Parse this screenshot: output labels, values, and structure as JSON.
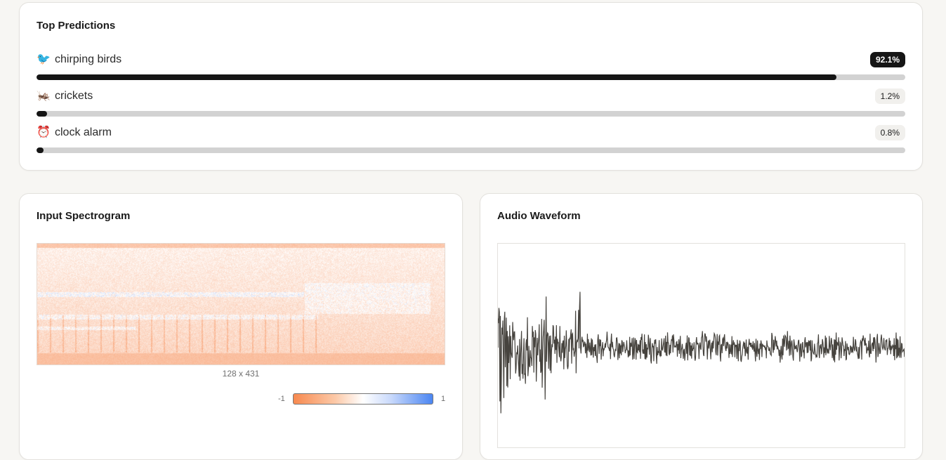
{
  "predictions": {
    "title": "Top Predictions",
    "items": [
      {
        "emoji": "🐦",
        "icon": "bird-icon",
        "label": "chirping birds",
        "percent_label": "92.1%",
        "value": 0.921,
        "top": true
      },
      {
        "emoji": "🦗",
        "icon": "cricket-icon",
        "label": "crickets",
        "percent_label": "1.2%",
        "value": 0.012,
        "top": false
      },
      {
        "emoji": "⏰",
        "icon": "alarm-clock-icon",
        "label": "clock alarm",
        "percent_label": "0.8%",
        "value": 0.008,
        "top": false
      }
    ]
  },
  "spectrogram": {
    "title": "Input Spectrogram",
    "shape_label": "128 x 431",
    "colorbar": {
      "min_label": "-1",
      "max_label": "1",
      "low_color": "#f7894f",
      "high_color": "#4b86f2"
    }
  },
  "waveform": {
    "title": "Audio Waveform",
    "color": "#46433e"
  },
  "colors": {
    "bar_fill": "#151515",
    "bar_track": "#d2d2d2",
    "background": "#f7f6f3"
  }
}
